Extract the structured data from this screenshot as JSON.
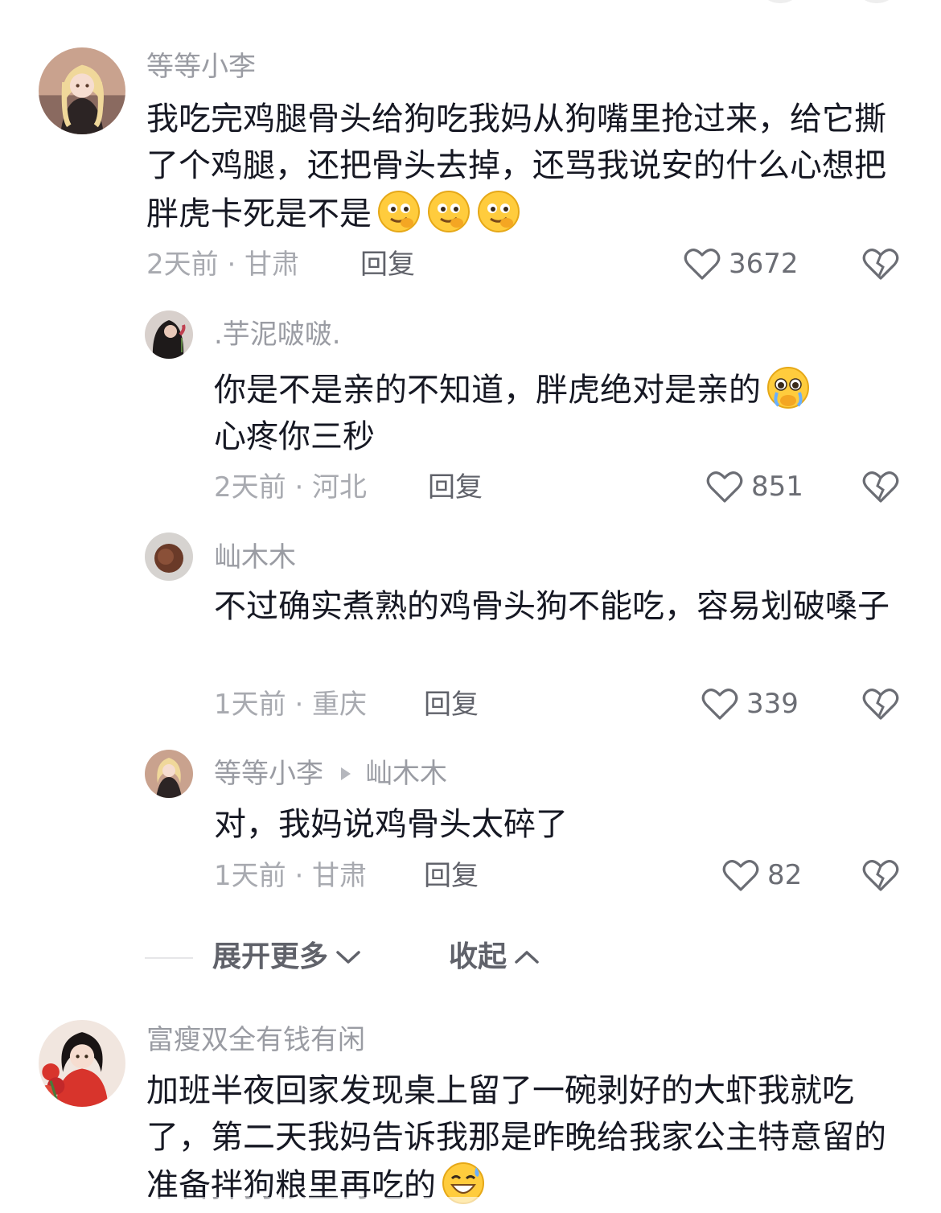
{
  "comments": [
    {
      "user": "等等小李",
      "text": "我吃完鸡腿骨头给狗吃我妈从狗嘴里抢过来，给它撕了个鸡腿，还把骨头去掉，还骂我说安的什么心想把胖虎卡死是不是",
      "emojis": [
        "yum-face",
        "yum-face",
        "yum-face"
      ],
      "meta": "2天前 · 甘肃",
      "reply_label": "回复",
      "likes": "3672"
    },
    {
      "user": ".芋泥啵啵.",
      "text": "你是不是亲的不知道，胖虎绝对是亲的",
      "text2": "心疼你三秒",
      "emojis": [
        "holding-back-tears-face"
      ],
      "meta": "2天前 · 河北",
      "reply_label": "回复",
      "likes": "851"
    },
    {
      "user": "屾木木",
      "text": "不过确实煮熟的鸡骨头狗不能吃，容易划破嗓子",
      "meta": "1天前 · 重庆",
      "reply_label": "回复",
      "likes": "339"
    },
    {
      "user": "等等小李",
      "reply_to": "屾木木",
      "text": "对，我妈说鸡骨头太碎了",
      "meta": "1天前 · 甘肃",
      "reply_label": "回复",
      "likes": "82"
    },
    {
      "user": "富瘦双全有钱有闲",
      "text": "加班半夜回家发现桌上留了一碗剥好的大虾我就吃了，第二天我妈告诉我那是昨晚给我家公主特意留的准备拌狗粮里再吃的",
      "emojis": [
        "grinning-sweat-face"
      ]
    }
  ],
  "expand_more": "展开更多",
  "collapse": "收起",
  "icons": {
    "like": "heart-outline-icon",
    "dislike": "broken-heart-icon",
    "expand": "chevron-down-icon",
    "collapse": "chevron-up-icon"
  }
}
